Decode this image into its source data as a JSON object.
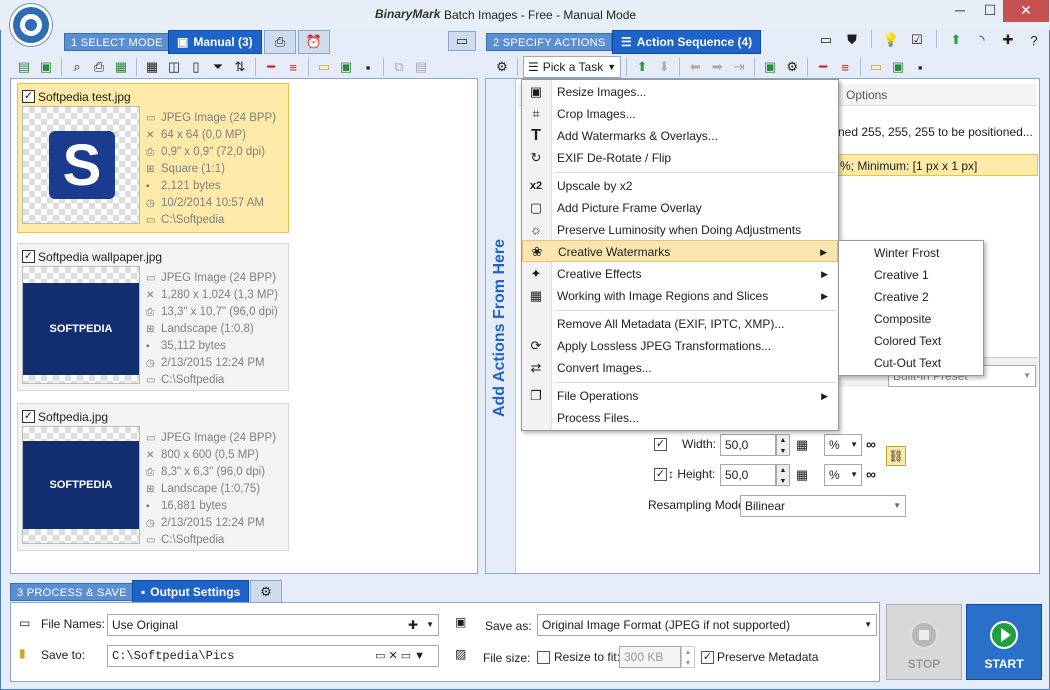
{
  "window": {
    "brand": "BinaryMark",
    "title": "Batch Images - Free - Manual Mode",
    "min": "─",
    "max": "☐",
    "close": "✕"
  },
  "select_mode": {
    "step_label": "1 SELECT MODE",
    "active_tab": "Manual (3)"
  },
  "specify_actions": {
    "step_label": "2 SPECIFY ACTIONS",
    "active_tab": "Action Sequence (4)"
  },
  "process_save": {
    "step_label": "3 PROCESS & SAVE",
    "active_tab": "Output Settings"
  },
  "files": [
    {
      "name": "Softpedia test.jpg",
      "type": "JPEG Image (24 BPP)",
      "dims": "64 x 64 (0,0 MP)",
      "print": "0,9\" x 0,9\" (72,0 dpi)",
      "shape": "Square (1:1)",
      "size": "2,121 bytes",
      "date": "10/2/2014 10:57 AM",
      "path": "C:\\Softpedia"
    },
    {
      "name": "Softpedia wallpaper.jpg",
      "type": "JPEG Image (24 BPP)",
      "dims": "1,280 x 1,024 (1,3 MP)",
      "print": "13,3\" x 10,7\" (96,0 dpi)",
      "shape": "Landscape (1:0,8)",
      "size": "35,112 bytes",
      "date": "2/13/2015 12:24 PM",
      "path": "C:\\Softpedia"
    },
    {
      "name": "Softpedia.jpg",
      "type": "JPEG Image (24 BPP)",
      "dims": "800 x 600 (0,5 MP)",
      "print": "8,3\" x 6,3\" (96,0 dpi)",
      "shape": "Landscape (1:0,75)",
      "size": "16,881 bytes",
      "date": "2/13/2015 12:24 PM",
      "path": "C:\\Softpedia"
    }
  ],
  "thumb_text": "SOFTPEDIA",
  "actions": {
    "pick_task": "Pick a Task",
    "vertical_label": "Add Actions From Here",
    "options_header": "Options",
    "row1_text": "ned 255, 255, 255 to be positioned...",
    "row2_text": "%; Minimum: [1 px x 1 px]",
    "preset": "Built-in Preset",
    "width_label": "Width:",
    "width_value": "50,0",
    "height_label": "Height:",
    "height_value": "50,0",
    "unit": "%",
    "resampling_label": "Resampling Mode:",
    "resampling_value": "Bilinear"
  },
  "menu": [
    {
      "label": "Resize Images...",
      "icon": "resize-icon",
      "glyph": "▣"
    },
    {
      "label": "Crop Images...",
      "icon": "crop-icon",
      "glyph": "⌗"
    },
    {
      "label": "Add Watermarks & Overlays...",
      "icon": "text-icon",
      "glyph": "T"
    },
    {
      "label": "EXIF De-Rotate / Flip",
      "icon": "rotate-icon",
      "glyph": "↻"
    },
    {
      "label": "Upscale by x2",
      "icon": "upscale-icon",
      "glyph": "x2"
    },
    {
      "label": "Add Picture Frame Overlay",
      "icon": "frame-icon",
      "glyph": "▢"
    },
    {
      "label": "Preserve Luminosity when Doing Adjustments",
      "icon": "sun-icon",
      "glyph": "☼"
    },
    {
      "label": "Creative Watermarks",
      "icon": "paw-icon",
      "glyph": "❀"
    },
    {
      "label": "Creative Effects",
      "icon": "wand-icon",
      "glyph": "✦"
    },
    {
      "label": "Working with Image Regions and Slices",
      "icon": "regions-icon",
      "glyph": "▦"
    },
    {
      "label": "Remove All Metadata (EXIF, IPTC, XMP)...",
      "icon": "",
      "glyph": ""
    },
    {
      "label": "Apply Lossless JPEG Transformations...",
      "icon": "lossless-icon",
      "glyph": "⟳"
    },
    {
      "label": "Convert Images...",
      "icon": "convert-icon",
      "glyph": "⇄"
    },
    {
      "label": "File Operations",
      "icon": "files-icon",
      "glyph": "❐"
    },
    {
      "label": "Process Files...",
      "icon": "",
      "glyph": ""
    }
  ],
  "submenu": [
    "Winter Frost",
    "Creative 1",
    "Creative 2",
    "Composite",
    "Colored Text",
    "Cut-Out Text"
  ],
  "output": {
    "file_names_label": "File Names:",
    "file_names_value": "Use Original",
    "save_to_label": "Save to:",
    "save_to_value": "C:\\Softpedia\\Pics",
    "save_as_label": "Save as:",
    "save_as_value": "Original Image Format (JPEG if not supported)",
    "file_size_label": "File size:",
    "resize_label": "Resize to fit:",
    "resize_value": "300 KB",
    "preserve_label": "Preserve Metadata",
    "stop": "STOP",
    "start": "START"
  },
  "colors": {
    "accent": "#1e64c8",
    "start": "#1fa03c",
    "selected_card": "#fdeaa8"
  }
}
